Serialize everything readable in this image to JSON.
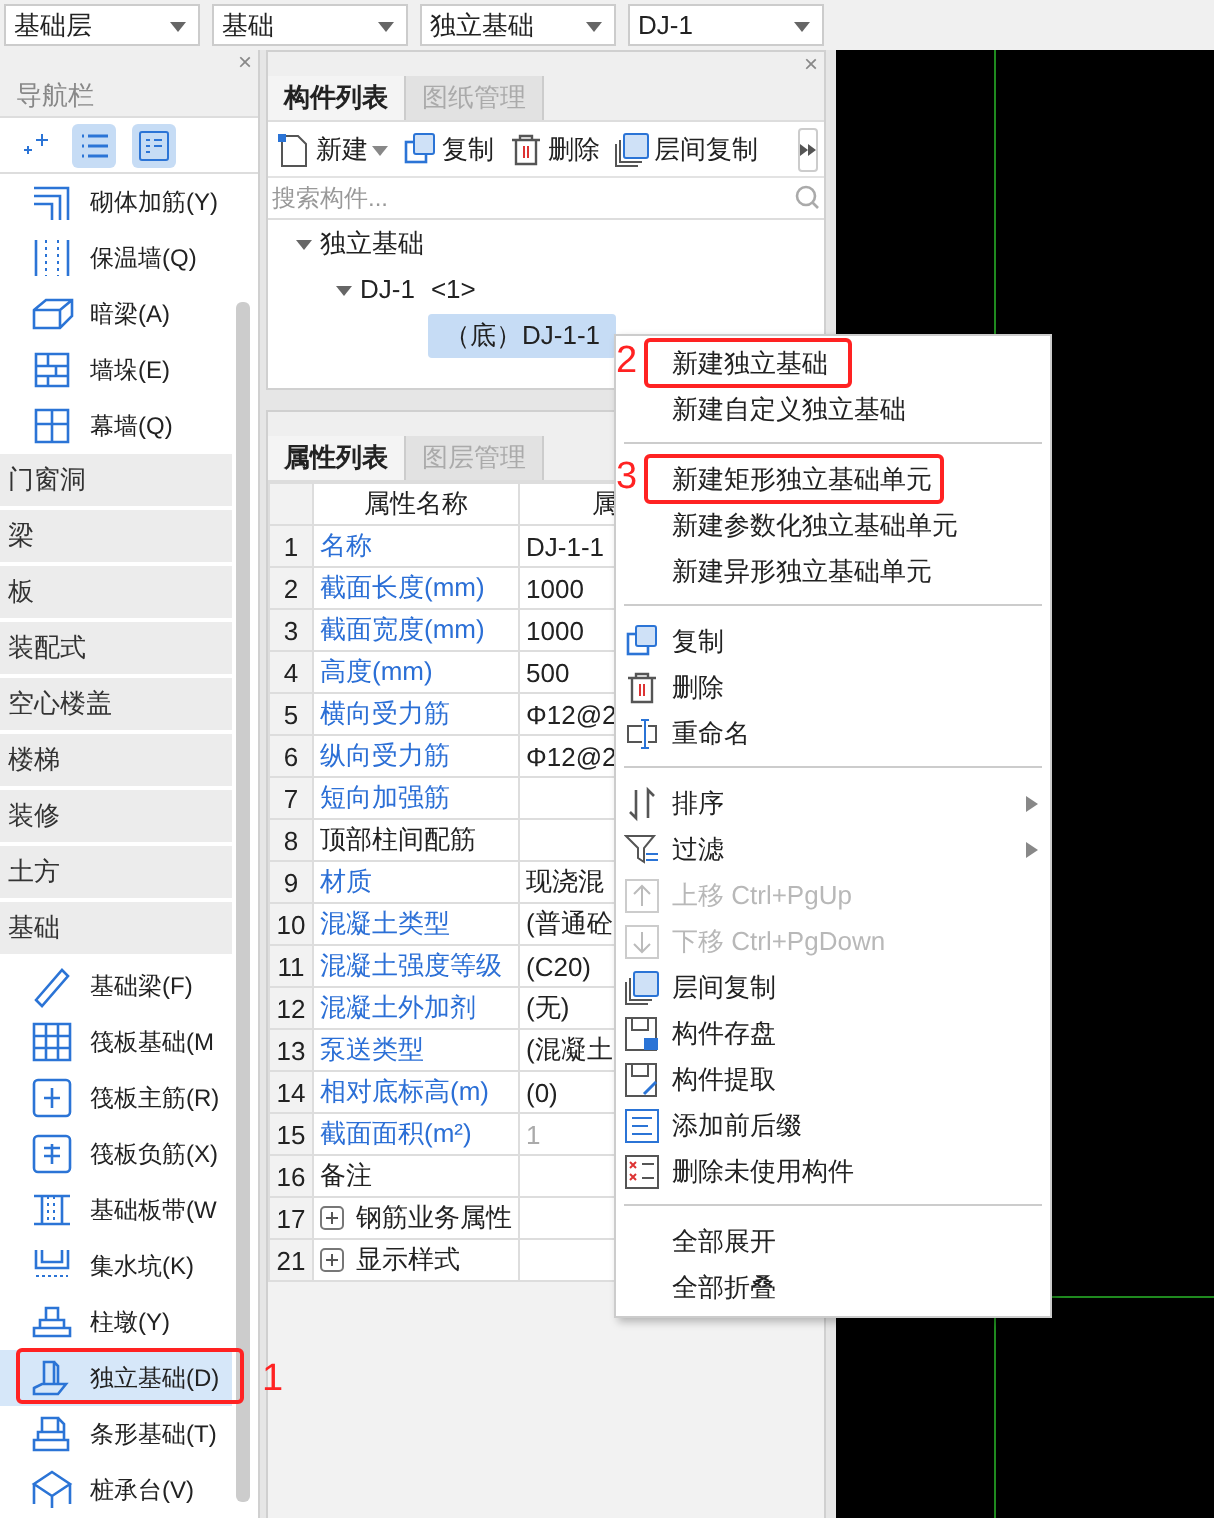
{
  "top_bar": {
    "dropdowns": [
      {
        "value": "基础层"
      },
      {
        "value": "基础"
      },
      {
        "value": "独立基础"
      },
      {
        "value": "DJ-1"
      }
    ]
  },
  "navigation": {
    "close": "×",
    "title": "导航栏",
    "view_buttons": [
      {
        "selected": false
      },
      {
        "selected": true
      },
      {
        "selected": true
      }
    ],
    "items": [
      {
        "kind": "item",
        "label": "砌体加筋(Y)",
        "selected": false
      },
      {
        "kind": "item",
        "label": "保温墙(Q)",
        "selected": false
      },
      {
        "kind": "item",
        "label": "暗梁(A)",
        "selected": false
      },
      {
        "kind": "item",
        "label": "墙垛(E)",
        "selected": false
      },
      {
        "kind": "item",
        "label": "幕墙(Q)",
        "selected": false
      },
      {
        "kind": "category",
        "label": "门窗洞"
      },
      {
        "kind": "category",
        "label": "梁"
      },
      {
        "kind": "category",
        "label": "板"
      },
      {
        "kind": "category",
        "label": "装配式"
      },
      {
        "kind": "category",
        "label": "空心楼盖"
      },
      {
        "kind": "category",
        "label": "楼梯"
      },
      {
        "kind": "category",
        "label": "装修"
      },
      {
        "kind": "category",
        "label": "土方"
      },
      {
        "kind": "category",
        "label": "基础"
      },
      {
        "kind": "item",
        "label": "基础梁(F)",
        "selected": false
      },
      {
        "kind": "item",
        "label": "筏板基础(M",
        "selected": false
      },
      {
        "kind": "item",
        "label": "筏板主筋(R)",
        "selected": false
      },
      {
        "kind": "item",
        "label": "筏板负筋(X)",
        "selected": false
      },
      {
        "kind": "item",
        "label": "基础板带(W",
        "selected": false
      },
      {
        "kind": "item",
        "label": "集水坑(K)",
        "selected": false
      },
      {
        "kind": "item",
        "label": "柱墩(Y)",
        "selected": false
      },
      {
        "kind": "item",
        "label": "独立基础(D)",
        "selected": true,
        "annotation": "1"
      },
      {
        "kind": "item",
        "label": "条形基础(T)",
        "selected": false
      },
      {
        "kind": "item",
        "label": "桩承台(V)",
        "selected": false
      }
    ]
  },
  "component_panel": {
    "close": "×",
    "tabs": [
      {
        "label": "构件列表",
        "selected": true
      },
      {
        "label": "图纸管理",
        "selected": false
      }
    ],
    "toolbar": [
      {
        "label": "新建",
        "dropdown": true
      },
      {
        "label": "复制",
        "dropdown": false
      },
      {
        "label": "删除",
        "dropdown": false
      },
      {
        "label": "层间复制",
        "dropdown": false
      }
    ],
    "search": {
      "placeholder": "搜索构件..."
    },
    "tree": [
      {
        "label": "独立基础",
        "expanded": true,
        "children": [
          {
            "label": "DJ-1",
            "count": "<1>",
            "expanded": true,
            "children": [
              {
                "label": "（底）DJ-1-1",
                "selected": true
              }
            ]
          }
        ]
      }
    ]
  },
  "property_panel": {
    "tabs": [
      {
        "label": "属性列表",
        "selected": true
      },
      {
        "label": "图层管理",
        "selected": false
      }
    ],
    "columns": [
      "属性名称",
      "属"
    ],
    "rows": [
      {
        "num": "1",
        "name": "名称",
        "value": "DJ-1-1",
        "linked": true
      },
      {
        "num": "2",
        "name": "截面长度(mm)",
        "value": "1000",
        "linked": true
      },
      {
        "num": "3",
        "name": "截面宽度(mm)",
        "value": "1000",
        "linked": true
      },
      {
        "num": "4",
        "name": "高度(mm)",
        "value": "500",
        "linked": true
      },
      {
        "num": "5",
        "name": "横向受力筋",
        "value": "Φ12@2",
        "linked": true
      },
      {
        "num": "6",
        "name": "纵向受力筋",
        "value": "Φ12@2",
        "linked": true
      },
      {
        "num": "7",
        "name": "短向加强筋",
        "linked": true
      },
      {
        "num": "8",
        "name": "顶部柱间配筋",
        "linked": false
      },
      {
        "num": "9",
        "name": "材质",
        "value": "现浇混",
        "linked": true
      },
      {
        "num": "10",
        "name": "混凝土类型",
        "value": "(普通砼",
        "linked": true
      },
      {
        "num": "11",
        "name": "混凝土强度等级",
        "value": "(C20)",
        "linked": true
      },
      {
        "num": "12",
        "name": "混凝土外加剂",
        "value": "(无)",
        "linked": true
      },
      {
        "num": "13",
        "name": "泵送类型",
        "value": "(混凝土",
        "linked": true
      },
      {
        "num": "14",
        "name": "相对底标高(m)",
        "value": "(0)",
        "linked": true
      },
      {
        "num": "15",
        "name": "截面面积(m²)",
        "value": "1",
        "linked": true,
        "disabled": true
      },
      {
        "num": "16",
        "name": "备注",
        "linked": false
      },
      {
        "num": "17",
        "name": "钢筋业务属性",
        "linked": false,
        "expanded": false
      },
      {
        "num": "21",
        "name": "显示样式",
        "linked": false,
        "expanded": false
      }
    ]
  },
  "context_menu": {
    "items": [
      {
        "kind": "item",
        "label": "新建独立基础",
        "annotation": "2"
      },
      {
        "kind": "item",
        "label": "新建自定义独立基础"
      },
      {
        "kind": "separator"
      },
      {
        "kind": "item",
        "label": "新建矩形独立基础单元",
        "annotation": "3"
      },
      {
        "kind": "item",
        "label": "新建参数化独立基础单元"
      },
      {
        "kind": "item",
        "label": "新建异形独立基础单元"
      },
      {
        "kind": "separator"
      },
      {
        "kind": "item",
        "label": "复制"
      },
      {
        "kind": "item",
        "label": "删除"
      },
      {
        "kind": "item",
        "label": "重命名"
      },
      {
        "kind": "separator"
      },
      {
        "kind": "item",
        "label": "排序",
        "submenu": true
      },
      {
        "kind": "item",
        "label": "过滤",
        "submenu": true
      },
      {
        "kind": "item",
        "label": "上移 Ctrl+PgUp",
        "disabled": true
      },
      {
        "kind": "item",
        "label": "下移 Ctrl+PgDown",
        "disabled": true
      },
      {
        "kind": "item",
        "label": "层间复制"
      },
      {
        "kind": "item",
        "label": "构件存盘"
      },
      {
        "kind": "item",
        "label": "构件提取"
      },
      {
        "kind": "item",
        "label": "添加前后缀"
      },
      {
        "kind": "item",
        "label": "删除未使用构件"
      },
      {
        "kind": "separator"
      },
      {
        "kind": "item",
        "label": "全部展开"
      },
      {
        "kind": "item",
        "label": "全部折叠"
      }
    ]
  }
}
